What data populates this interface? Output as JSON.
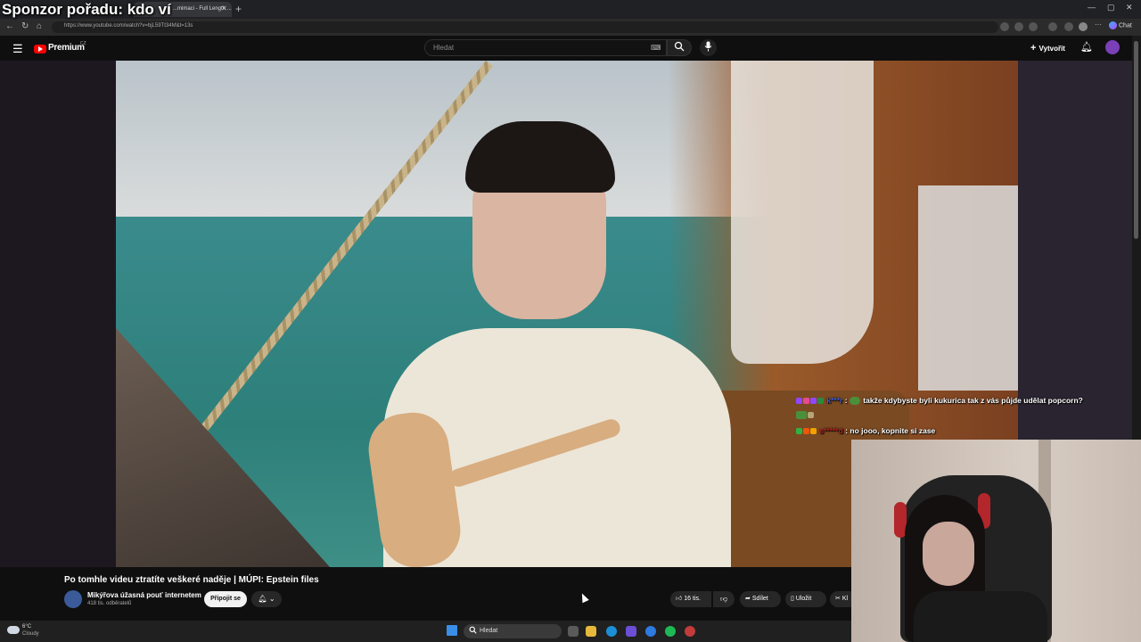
{
  "overlay": {
    "title": "Sponzor pořadu: kdo ví"
  },
  "browser": {
    "tab_title": "...mimaci - Full Length ...",
    "url": "https://www.youtube.com/watch?v=bjL59Tt34M&t=13s",
    "chat_button": "Chat",
    "window_controls": [
      "minimize-icon",
      "maximize-icon",
      "close-icon"
    ]
  },
  "youtube": {
    "logo_text": "Premium",
    "logo_sup": "CZ",
    "search_placeholder": "Hledat",
    "create_label": "Vytvořit"
  },
  "video": {
    "title": "Po tomhle videu ztratíte veškeré naděje | MÚPI: Epstein files",
    "channel": "Mikýřova úžasná pouť internetem",
    "subscribers": "418 tis. odběratelů",
    "join_label": "Připojit se",
    "likes": "16 tis.",
    "share_label": "Sdílet",
    "save_label": "Uložit",
    "clip_label": "Kl"
  },
  "chat": [
    {
      "user": "k***r",
      "message": "takže kdybyste byli kukurica tak z vás půjde udělat popcorn?",
      "user_color": "#3b5bdb"
    },
    {
      "user": "s*****d",
      "message": "no jooo, kopnite si zase",
      "user_color": "#b22222"
    }
  ],
  "taskbar": {
    "temperature": "6°C",
    "weather": "Cloudy",
    "search_label": "Hledat"
  }
}
